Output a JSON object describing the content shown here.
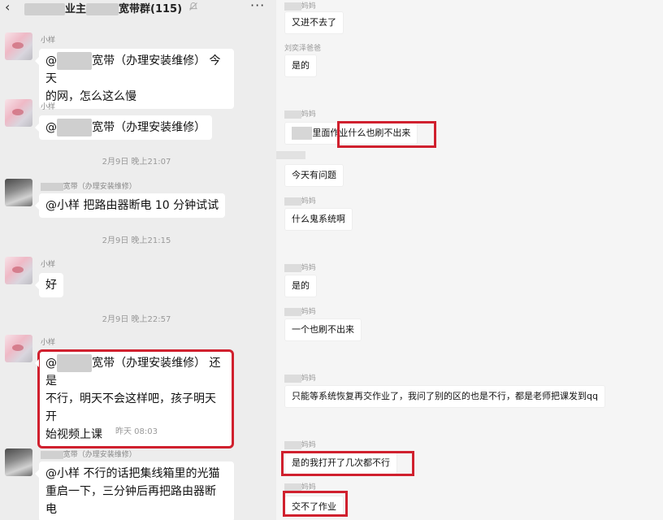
{
  "header": {
    "title_prefix": "业主",
    "title_suffix": "宽带群(115)",
    "title_blur1": "█████",
    "title_blur2": "████",
    "back_glyph": "‹",
    "more_glyph": "···"
  },
  "left_messages": [
    {
      "sender": "小样",
      "lines": [
        "@",
        "宽带（办理安装维修） 今天",
        "的网，怎么这么慢"
      ]
    },
    {
      "sender": "小样",
      "lines": [
        "@",
        "宽带（办理安装维修）"
      ]
    },
    {
      "sender": "宽带（办理安装维修）",
      "text": "@小样  把路由器断电 10 分钟试试"
    },
    {
      "sender": "小样",
      "text": "好"
    },
    {
      "sender": "小样",
      "lines": [
        "@",
        "宽带（办理安装维修） 还是",
        "不行，明天不会这样吧，孩子明天开",
        "始视频上课"
      ]
    },
    {
      "sender": "宽带（办理安装维修）",
      "lines": [
        "@小样  不行的话把集线箱里的光猫",
        "重启一下，三分钟后再把路由器断",
        "电"
      ]
    }
  ],
  "timestamps": [
    "2月9日 晚上21:07",
    "2月9日 晚上21:15",
    "2月9日 晚上22:57",
    "昨天 08:03"
  ],
  "right_messages": [
    {
      "name": "妈妈",
      "text": "又进不去了"
    },
    {
      "name": "刘奕泽爸爸",
      "text": "是的"
    },
    {
      "name": "妈妈",
      "text_blur": "███",
      "text": "里面作业什么也刷不出来"
    },
    {
      "name": "",
      "text": "今天有问题"
    },
    {
      "name": "妈妈",
      "text": "什么鬼系统啊"
    },
    {
      "name": "妈妈",
      "text": "是的"
    },
    {
      "name": "妈妈",
      "text": "一个也刷不出来"
    },
    {
      "name": "妈妈",
      "text": "只能等系统恢复再交作业了，我问了别的区的也是不行，都是老师把课发到qq"
    },
    {
      "name": "妈妈",
      "text": "是的我打开了几次都不行"
    },
    {
      "name": "妈妈",
      "text": "交不了作业"
    }
  ],
  "colors": {
    "highlight": "#d0202e",
    "bubble": "#ffffff",
    "background": "#ededed"
  },
  "icons": {
    "back": "back-chevron-icon",
    "mute": "bell-muted-icon",
    "more": "more-dots-icon"
  }
}
